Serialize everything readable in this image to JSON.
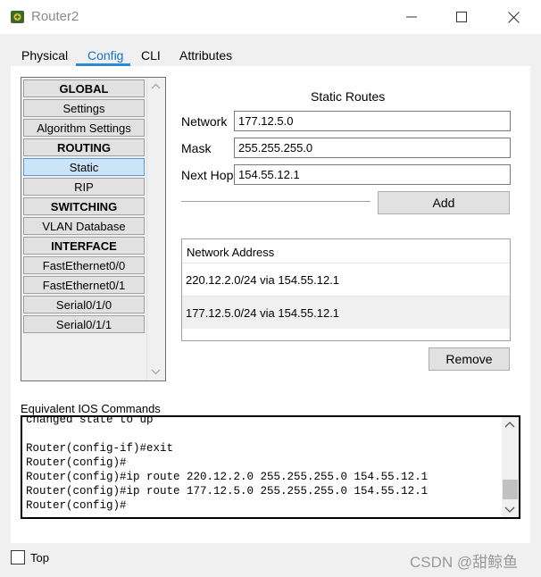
{
  "window": {
    "title": "Router2",
    "icon": "router-icon"
  },
  "tabs": [
    {
      "label": "Physical"
    },
    {
      "label": "Config",
      "active": true
    },
    {
      "label": "CLI"
    },
    {
      "label": "Attributes"
    }
  ],
  "sidebar": {
    "items": [
      {
        "label": "GLOBAL",
        "type": "header"
      },
      {
        "label": "Settings"
      },
      {
        "label": "Algorithm Settings"
      },
      {
        "label": "ROUTING",
        "type": "header"
      },
      {
        "label": "Static",
        "selected": true
      },
      {
        "label": "RIP"
      },
      {
        "label": "SWITCHING",
        "type": "header"
      },
      {
        "label": "VLAN Database"
      },
      {
        "label": "INTERFACE",
        "type": "header"
      },
      {
        "label": "FastEthernet0/0"
      },
      {
        "label": "FastEthernet0/1"
      },
      {
        "label": "Serial0/1/0"
      },
      {
        "label": "Serial0/1/1"
      }
    ]
  },
  "static_routes": {
    "title": "Static Routes",
    "network_label": "Network",
    "network_value": "177.12.5.0",
    "mask_label": "Mask",
    "mask_value": "255.255.255.0",
    "next_hop_label": "Next Hop",
    "next_hop_value": "154.55.12.1",
    "add_label": "Add",
    "list_header": "Network Address",
    "routes": [
      "220.12.2.0/24 via 154.55.12.1",
      "177.12.5.0/24 via 154.55.12.1"
    ],
    "remove_label": "Remove"
  },
  "ios": {
    "label": "Equivalent IOS Commands",
    "lines": [
      "changed state to up",
      "",
      "Router(config-if)#exit",
      "Router(config)#",
      "Router(config)#ip route 220.12.2.0 255.255.255.0 154.55.12.1",
      "Router(config)#ip route 177.12.5.0 255.255.255.0 154.55.12.1",
      "Router(config)#"
    ]
  },
  "footer": {
    "top_label": "Top",
    "top_checked": false,
    "watermark": "CSDN @甜鲸鱼"
  },
  "colors": {
    "accent": "#2a8ad6",
    "selected_bg": "#cce4f7"
  }
}
